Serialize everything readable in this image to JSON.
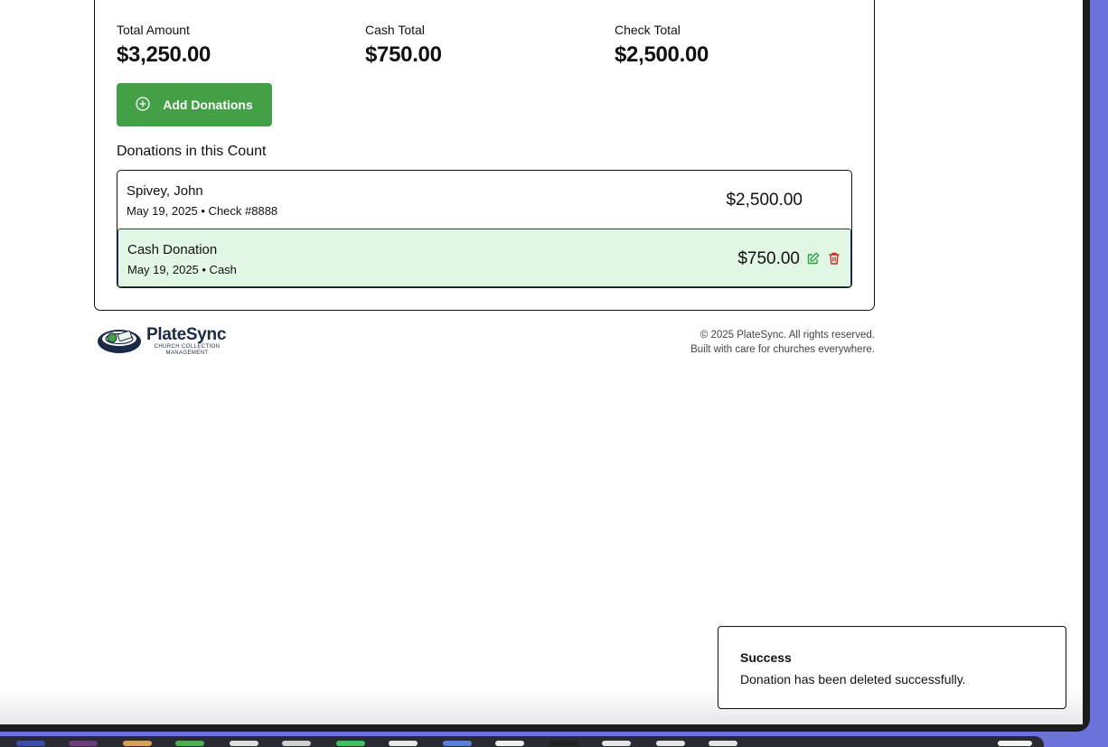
{
  "summary": {
    "total_label": "Total Amount",
    "total_value": "$3,250.00",
    "cash_label": "Cash Total",
    "cash_value": "$750.00",
    "check_label": "Check Total",
    "check_value": "$2,500.00"
  },
  "add_button": {
    "label": "Add Donations",
    "icon": "plus-circle-icon"
  },
  "donations_section": {
    "title": "Donations in this Count",
    "items": [
      {
        "name": "Spivey, John",
        "meta": "May 19, 2025 • Check #8888",
        "amount": "$2,500.00"
      },
      {
        "name": "Cash Donation",
        "meta": "May 19, 2025 • Cash",
        "amount": "$750.00",
        "actions": [
          "edit-icon",
          "trash-icon"
        ]
      }
    ]
  },
  "footer": {
    "logo_name": "PlateSync",
    "logo_tagline": "CHURCH COLLECTION MANAGEMENT",
    "copyright": "© 2025 PlateSync. All rights reserved.",
    "tagline": "Built with care for churches everywhere."
  },
  "toast": {
    "title": "Success",
    "message": "Donation has been deleted successfully."
  },
  "colors": {
    "accent_green": "#43a047",
    "selected_row_bg": "#e1f7e4",
    "selected_row_border": "#1f3a8a",
    "delete_red": "#c62828",
    "edit_green": "#2e9e44",
    "logo_navy": "#1b2b45"
  }
}
